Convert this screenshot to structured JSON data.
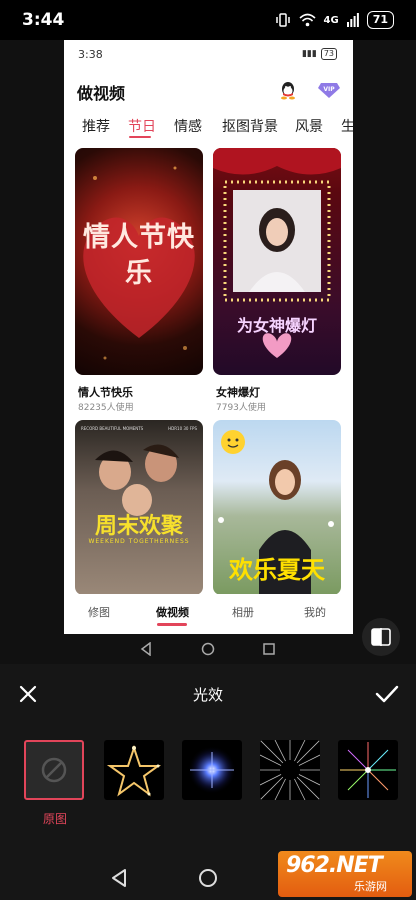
{
  "status_bar": {
    "time": "3:44",
    "battery": "71",
    "signal": "4G"
  },
  "preview": {
    "status": {
      "time": "3:38",
      "battery": "73"
    },
    "app_title": "做视频",
    "tabs": [
      "推荐",
      "节日",
      "情感",
      "抠图背景",
      "风景",
      "生"
    ],
    "active_tab_index": 1,
    "cards": [
      {
        "title": "情人节快乐",
        "usage": "82235人使用",
        "overlay": "情人节快乐"
      },
      {
        "title": "女神爆灯",
        "usage": "7793人使用",
        "overlay": "为女神爆灯"
      },
      {
        "overlay": "周末欢聚",
        "overlay_sub": "WEEKEND TOGETHERNESS",
        "top_text_left": "RECORD BEAUTIFUL MOMENTS",
        "top_text_right": "HDR10 30 FPS"
      },
      {
        "overlay": "欢乐夏天"
      }
    ],
    "bottom_nav": [
      "修图",
      "做视频",
      "相册",
      "我的"
    ],
    "active_nav_index": 1
  },
  "editor": {
    "title": "光效",
    "selected_label": "原图",
    "effects": [
      "none-icon",
      "star-sparkle",
      "blue-flare",
      "radial-burst",
      "rainbow-burst"
    ]
  },
  "watermark": {
    "main": "962.NET",
    "sub": "乐游网"
  },
  "colors": {
    "accent": "#e2455a",
    "editor_bg": "#161616",
    "watermark": "#ef7a18"
  }
}
